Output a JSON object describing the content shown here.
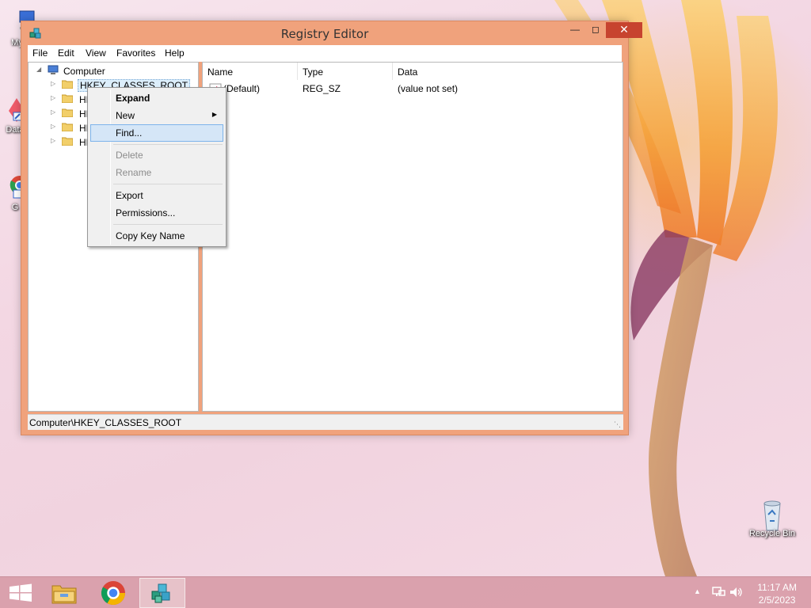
{
  "desktop": {
    "icons": [
      {
        "label": "My C"
      },
      {
        "label": "Data"
      },
      {
        "label": "G"
      },
      {
        "label": "Recycle Bin"
      }
    ]
  },
  "window": {
    "title": "Registry Editor",
    "menu": [
      "File",
      "Edit",
      "View",
      "Favorites",
      "Help"
    ],
    "tree": {
      "root": "Computer",
      "keys": [
        "HKEY_CLASSES_ROOT",
        "HK",
        "HK",
        "HK",
        "HK"
      ]
    },
    "list": {
      "columns": [
        "Name",
        "Type",
        "Data"
      ],
      "rows": [
        {
          "name": "(Default)",
          "type": "REG_SZ",
          "data": "(value not set)"
        }
      ]
    },
    "status": "Computer\\HKEY_CLASSES_ROOT"
  },
  "context_menu": {
    "items": [
      {
        "label": "Expand",
        "style": "bold"
      },
      {
        "label": "New",
        "submenu": true
      },
      {
        "label": "Find...",
        "highlighted": true
      },
      {
        "label": "Delete",
        "disabled": true
      },
      {
        "label": "Rename",
        "disabled": true
      },
      {
        "label": "Export"
      },
      {
        "label": "Permissions..."
      },
      {
        "label": "Copy Key Name"
      }
    ]
  },
  "taskbar": {
    "clock_time": "11:17 AM",
    "clock_date": "2/5/2023"
  },
  "colors": {
    "window_frame": "#f0a27c",
    "close_button": "#c7432f",
    "menu_highlight": "#d5e6f7",
    "taskbar": "#d89ca8"
  }
}
